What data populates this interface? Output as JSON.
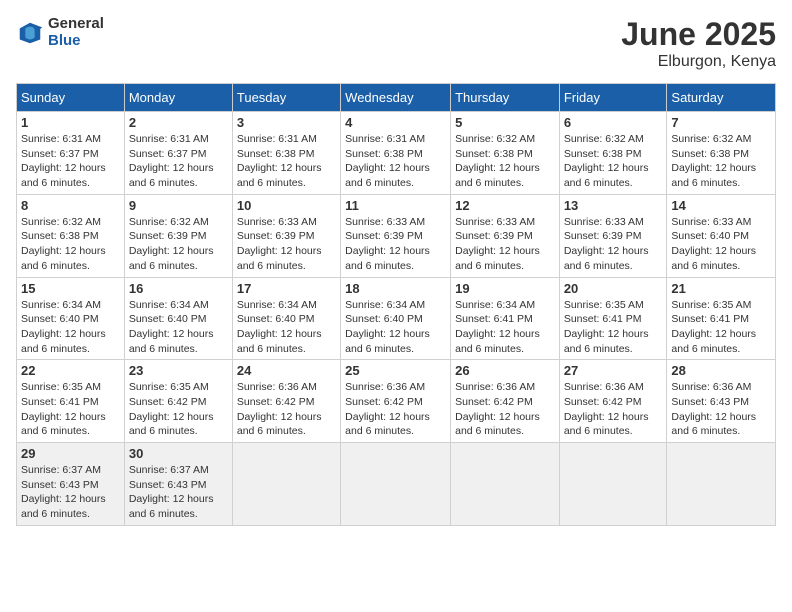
{
  "logo": {
    "general": "General",
    "blue": "Blue"
  },
  "title": {
    "month": "June 2025",
    "location": "Elburgon, Kenya"
  },
  "days_of_week": [
    "Sunday",
    "Monday",
    "Tuesday",
    "Wednesday",
    "Thursday",
    "Friday",
    "Saturday"
  ],
  "weeks": [
    [
      {
        "day": "1",
        "sunrise": "6:31 AM",
        "sunset": "6:37 PM",
        "daylight": "12 hours and 6 minutes."
      },
      {
        "day": "2",
        "sunrise": "6:31 AM",
        "sunset": "6:37 PM",
        "daylight": "12 hours and 6 minutes."
      },
      {
        "day": "3",
        "sunrise": "6:31 AM",
        "sunset": "6:38 PM",
        "daylight": "12 hours and 6 minutes."
      },
      {
        "day": "4",
        "sunrise": "6:31 AM",
        "sunset": "6:38 PM",
        "daylight": "12 hours and 6 minutes."
      },
      {
        "day": "5",
        "sunrise": "6:32 AM",
        "sunset": "6:38 PM",
        "daylight": "12 hours and 6 minutes."
      },
      {
        "day": "6",
        "sunrise": "6:32 AM",
        "sunset": "6:38 PM",
        "daylight": "12 hours and 6 minutes."
      },
      {
        "day": "7",
        "sunrise": "6:32 AM",
        "sunset": "6:38 PM",
        "daylight": "12 hours and 6 minutes."
      }
    ],
    [
      {
        "day": "8",
        "sunrise": "6:32 AM",
        "sunset": "6:38 PM",
        "daylight": "12 hours and 6 minutes."
      },
      {
        "day": "9",
        "sunrise": "6:32 AM",
        "sunset": "6:39 PM",
        "daylight": "12 hours and 6 minutes."
      },
      {
        "day": "10",
        "sunrise": "6:33 AM",
        "sunset": "6:39 PM",
        "daylight": "12 hours and 6 minutes."
      },
      {
        "day": "11",
        "sunrise": "6:33 AM",
        "sunset": "6:39 PM",
        "daylight": "12 hours and 6 minutes."
      },
      {
        "day": "12",
        "sunrise": "6:33 AM",
        "sunset": "6:39 PM",
        "daylight": "12 hours and 6 minutes."
      },
      {
        "day": "13",
        "sunrise": "6:33 AM",
        "sunset": "6:39 PM",
        "daylight": "12 hours and 6 minutes."
      },
      {
        "day": "14",
        "sunrise": "6:33 AM",
        "sunset": "6:40 PM",
        "daylight": "12 hours and 6 minutes."
      }
    ],
    [
      {
        "day": "15",
        "sunrise": "6:34 AM",
        "sunset": "6:40 PM",
        "daylight": "12 hours and 6 minutes."
      },
      {
        "day": "16",
        "sunrise": "6:34 AM",
        "sunset": "6:40 PM",
        "daylight": "12 hours and 6 minutes."
      },
      {
        "day": "17",
        "sunrise": "6:34 AM",
        "sunset": "6:40 PM",
        "daylight": "12 hours and 6 minutes."
      },
      {
        "day": "18",
        "sunrise": "6:34 AM",
        "sunset": "6:40 PM",
        "daylight": "12 hours and 6 minutes."
      },
      {
        "day": "19",
        "sunrise": "6:34 AM",
        "sunset": "6:41 PM",
        "daylight": "12 hours and 6 minutes."
      },
      {
        "day": "20",
        "sunrise": "6:35 AM",
        "sunset": "6:41 PM",
        "daylight": "12 hours and 6 minutes."
      },
      {
        "day": "21",
        "sunrise": "6:35 AM",
        "sunset": "6:41 PM",
        "daylight": "12 hours and 6 minutes."
      }
    ],
    [
      {
        "day": "22",
        "sunrise": "6:35 AM",
        "sunset": "6:41 PM",
        "daylight": "12 hours and 6 minutes."
      },
      {
        "day": "23",
        "sunrise": "6:35 AM",
        "sunset": "6:42 PM",
        "daylight": "12 hours and 6 minutes."
      },
      {
        "day": "24",
        "sunrise": "6:36 AM",
        "sunset": "6:42 PM",
        "daylight": "12 hours and 6 minutes."
      },
      {
        "day": "25",
        "sunrise": "6:36 AM",
        "sunset": "6:42 PM",
        "daylight": "12 hours and 6 minutes."
      },
      {
        "day": "26",
        "sunrise": "6:36 AM",
        "sunset": "6:42 PM",
        "daylight": "12 hours and 6 minutes."
      },
      {
        "day": "27",
        "sunrise": "6:36 AM",
        "sunset": "6:42 PM",
        "daylight": "12 hours and 6 minutes."
      },
      {
        "day": "28",
        "sunrise": "6:36 AM",
        "sunset": "6:43 PM",
        "daylight": "12 hours and 6 minutes."
      }
    ],
    [
      {
        "day": "29",
        "sunrise": "6:37 AM",
        "sunset": "6:43 PM",
        "daylight": "12 hours and 6 minutes."
      },
      {
        "day": "30",
        "sunrise": "6:37 AM",
        "sunset": "6:43 PM",
        "daylight": "12 hours and 6 minutes."
      },
      null,
      null,
      null,
      null,
      null
    ]
  ]
}
